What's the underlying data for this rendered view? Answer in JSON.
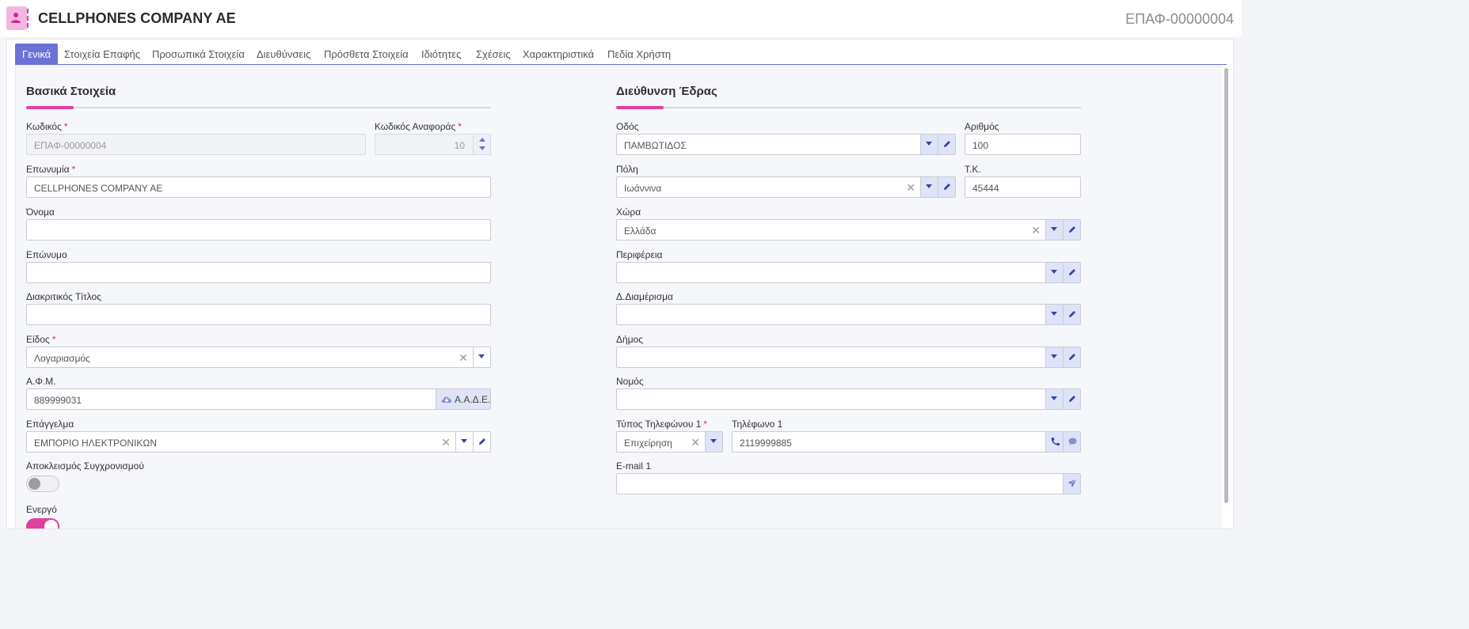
{
  "header": {
    "title": "CELLPHONES COMPANY AE",
    "record_code": "ΕΠΑΦ-00000004"
  },
  "tabs": [
    {
      "label": "Γενικά",
      "active": true
    },
    {
      "label": "Στοιχεία Επαφής"
    },
    {
      "label": "Προσωπικά Στοιχεία"
    },
    {
      "label": "Διευθύνσεις"
    },
    {
      "label": "Πρόσθετα Στοιχεία"
    },
    {
      "label": "Ιδιότητες"
    },
    {
      "label": "Σχέσεις"
    },
    {
      "label": "Χαρακτηριστικά"
    },
    {
      "label": "Πεδία Χρήστη"
    }
  ],
  "basic": {
    "section_title": "Βασικά Στοιχεία",
    "code_label": "Κωδικός",
    "code_value": "ΕΠΑΦ-00000004",
    "ref_code_label": "Κωδικός Αναφοράς",
    "ref_code_value": "10",
    "name_label": "Επωνυμία",
    "name_value": "CELLPHONES COMPANY AE",
    "first_name_label": "Όνομα",
    "first_name_value": "",
    "last_name_label": "Επώνυμο",
    "last_name_value": "",
    "trade_title_label": "Διακριτικός Τίτλος",
    "trade_title_value": "",
    "type_label": "Είδος",
    "type_value": "Λογαριασμός",
    "vat_label": "Α.Φ.Μ.",
    "vat_value": "889999031",
    "aade_label": "Α.Α.Δ.Ε.",
    "profession_label": "Επάγγελμα",
    "profession_value": "ΕΜΠΟΡΙΟ ΗΛΕΚΤΡΟΝΙΚΩΝ",
    "sync_exclusion_label": "Αποκλεισμός Συγχρονισμού",
    "sync_exclusion_on": false,
    "active_label": "Ενεργό",
    "active_on": true,
    "required_mark": "*"
  },
  "address": {
    "section_title": "Διεύθυνση Έδρας",
    "street_label": "Οδός",
    "street_value": "ΠΑΜΒΩΤΙΔΟΣ",
    "number_label": "Αριθμός",
    "number_value": "100",
    "city_label": "Πόλη",
    "city_value": "Ιωάννινα",
    "postal_label": "Τ.Κ.",
    "postal_value": "45444",
    "country_label": "Χώρα",
    "country_value": "Ελλάδα",
    "region_label": "Περιφέρεια",
    "region_value": "",
    "district_label": "Δ.Διαμέρισμα",
    "district_value": "",
    "municipality_label": "Δήμος",
    "municipality_value": "",
    "prefecture_label": "Νομός",
    "prefecture_value": "",
    "phone_type_label": "Τύπος Τηλεφώνου 1",
    "phone_type_value": "Επιχείρηση",
    "phone_label": "Τηλέφωνο 1",
    "phone_value": "2119999885",
    "email_label": "E-mail 1",
    "email_value": ""
  },
  "colors": {
    "accent": "#6b72d6",
    "brand_pink": "#e040a0",
    "required": "#e03030"
  },
  "icons": [
    "contact-card-icon",
    "chevron-down-icon",
    "pencil-icon",
    "clear-icon",
    "cloud-download-icon",
    "phone-icon",
    "chat-icon",
    "send-icon",
    "stepper-icon"
  ]
}
